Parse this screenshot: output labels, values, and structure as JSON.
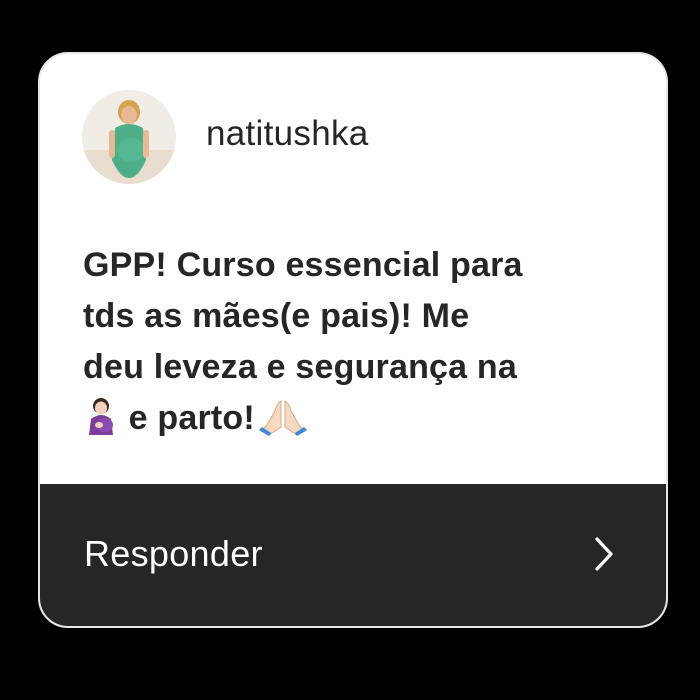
{
  "post": {
    "username": "natitushka",
    "avatar_icon": "user-avatar-photo",
    "message_lines": [
      "GPP! Curso essencial para",
      "tds as mães(e pais)! Me",
      "deu leveza e segurança na"
    ],
    "message_last_text": " e parto!",
    "emojis": [
      "pregnant-woman-emoji",
      "folded-hands-emoji"
    ]
  },
  "footer": {
    "reply_label": "Responder",
    "chevron_icon": "chevron-right-icon"
  },
  "colors": {
    "background": "#000000",
    "card": "#ffffff",
    "text": "#262626",
    "footer": "#262626",
    "footer_text": "#ffffff"
  }
}
